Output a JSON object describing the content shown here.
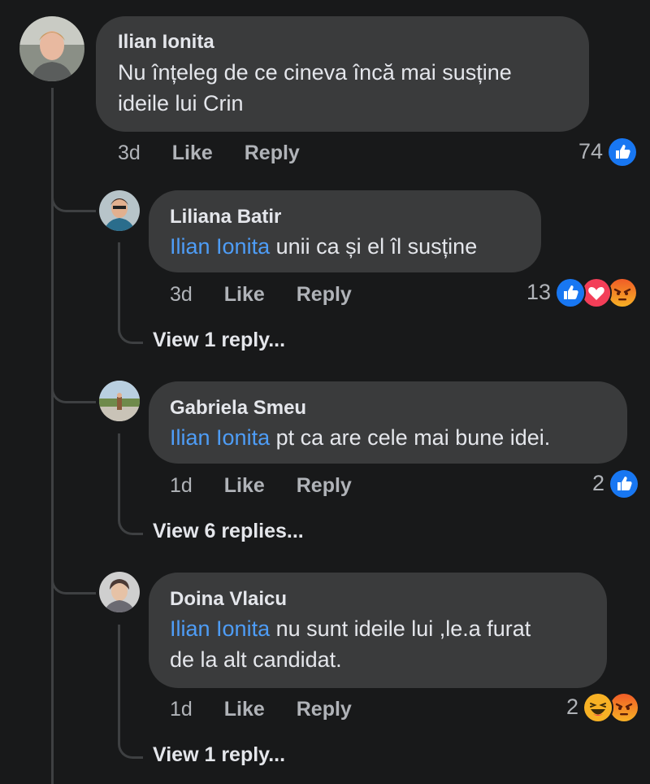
{
  "comments": [
    {
      "author": "Ilian Ionita",
      "text_line1": "Nu înțeleg de ce cineva încă mai susține",
      "text_line2": "ideile lui Crin",
      "time": "3d",
      "like": "Like",
      "reply": "Reply",
      "reaction_count": "74",
      "reactions": [
        "like"
      ]
    },
    {
      "author": "Liliana Batir",
      "mention": "Ilian Ionita",
      "text": " unii ca și el îl susține",
      "time": "3d",
      "like": "Like",
      "reply": "Reply",
      "reaction_count": "13",
      "reactions": [
        "like",
        "love",
        "angry"
      ],
      "view_replies": "View 1 reply..."
    },
    {
      "author": "Gabriela Smeu",
      "mention": "Ilian Ionita",
      "text": " pt ca are cele mai bune idei.",
      "time": "1d",
      "like": "Like",
      "reply": "Reply",
      "reaction_count": "2",
      "reactions": [
        "like"
      ],
      "view_replies": "View 6 replies..."
    },
    {
      "author": "Doina Vlaicu",
      "mention": "Ilian Ionita",
      "text_line1": " nu sunt ideile lui ,le.a furat",
      "text_line2": "de la alt candidat.",
      "time": "1d",
      "like": "Like",
      "reply": "Reply",
      "reaction_count": "2",
      "reactions": [
        "haha",
        "angry"
      ],
      "view_replies": "View 1 reply..."
    }
  ],
  "colors": {
    "background": "#18191a",
    "bubble": "#3a3b3c",
    "mention": "#4e9df7",
    "like": "#1877f2",
    "love": "#f33e58",
    "angry": "#e9710f",
    "haha": "#f7b125"
  }
}
